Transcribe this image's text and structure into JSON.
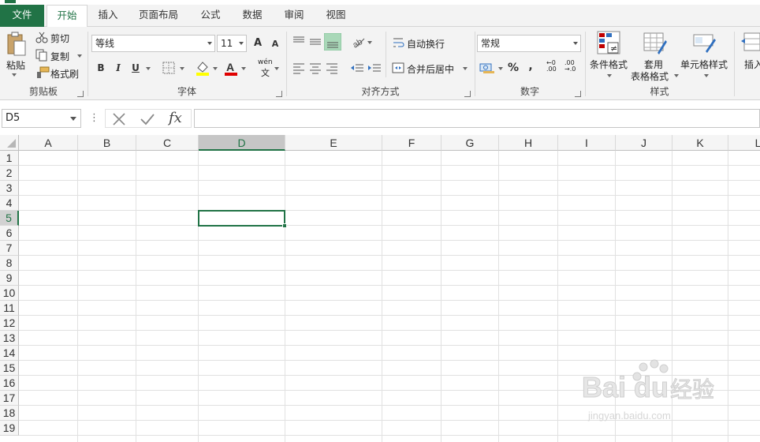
{
  "tabs": {
    "file": "文件",
    "items": [
      "开始",
      "插入",
      "页面布局",
      "公式",
      "数据",
      "审阅",
      "视图"
    ]
  },
  "ribbon": {
    "clipboard": {
      "paste": "粘贴",
      "cut": "剪切",
      "copy": "复制",
      "format_painter": "格式刷",
      "title": "剪贴板"
    },
    "font": {
      "font_name": "等线",
      "font_size": "11",
      "bold": "B",
      "italic": "I",
      "underline": "U",
      "grow": "A",
      "shrink": "A",
      "wen": "wén",
      "wen_zi": "文",
      "title": "字体"
    },
    "alignment": {
      "wrap_text": "自动换行",
      "merge_center": "合并后居中",
      "title": "对齐方式"
    },
    "number": {
      "format": "常规",
      "percent": "%",
      "comma": ",",
      "inc_decimal_a": "←0",
      "inc_decimal_b": ".00",
      "dec_decimal_a": ".00",
      "dec_decimal_b": "→.0",
      "title": "数字"
    },
    "styles": {
      "conditional": "条件格式",
      "table_format_1": "套用",
      "table_format_2": "表格格式",
      "cell_styles": "单元格样式",
      "title": "样式"
    },
    "cells": {
      "insert": "插入"
    }
  },
  "formula_bar": {
    "name_box": "D5",
    "fx": "fx",
    "value": ""
  },
  "grid": {
    "columns": [
      "A",
      "B",
      "C",
      "D",
      "E",
      "F",
      "G",
      "H",
      "I",
      "J",
      "K",
      "L"
    ],
    "rows": [
      "1",
      "2",
      "3",
      "4",
      "5",
      "6",
      "7",
      "8",
      "9",
      "10",
      "11",
      "12",
      "13",
      "14",
      "15",
      "16",
      "17",
      "18",
      "19"
    ],
    "selected_column": "D",
    "selected_row": "5"
  },
  "watermark": {
    "brand": "Bai",
    "brand2": "du",
    "jingyan": "经验",
    "url": "jingyan.baidu.com"
  },
  "colors": {
    "accent": "#217346",
    "font_color": "#e00000",
    "highlight": "#ffff00"
  }
}
